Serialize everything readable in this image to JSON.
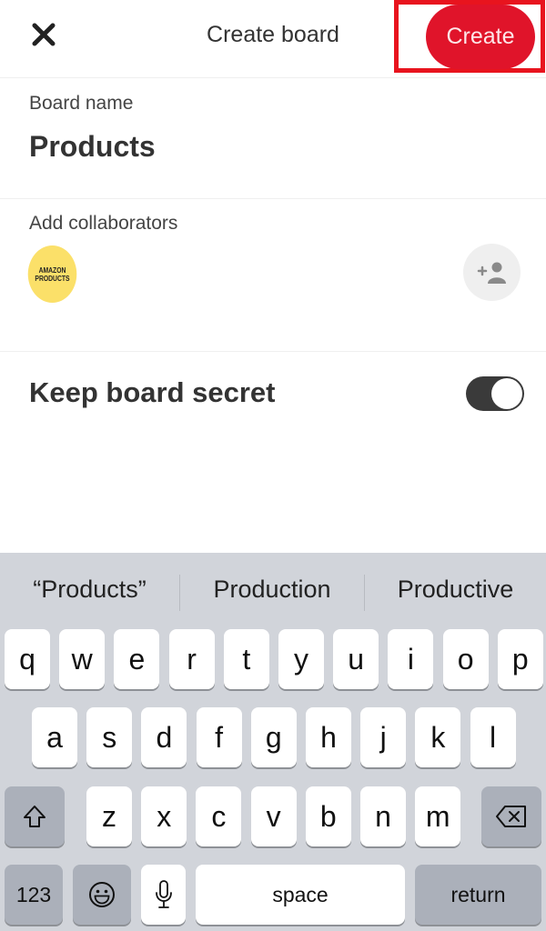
{
  "header": {
    "close_icon": "close-icon",
    "title": "Create board",
    "create_label": "Create",
    "create_color": "#e0142a",
    "highlight_color": "#e8141e"
  },
  "board_name": {
    "label": "Board name",
    "value": "Products"
  },
  "collaborators": {
    "label": "Add collaborators",
    "avatar_line1": "AMAZON",
    "avatar_line2": "PRODUCTS",
    "add_icon": "add-person-icon"
  },
  "secret": {
    "label": "Keep board secret",
    "enabled": true
  },
  "keyboard": {
    "suggestions": [
      "“Products”",
      "Production",
      "Productive"
    ],
    "row1": [
      "q",
      "w",
      "e",
      "r",
      "t",
      "y",
      "u",
      "i",
      "o",
      "p"
    ],
    "row2": [
      "a",
      "s",
      "d",
      "f",
      "g",
      "h",
      "j",
      "k",
      "l"
    ],
    "row3": [
      "z",
      "x",
      "c",
      "v",
      "b",
      "n",
      "m"
    ],
    "shift_icon": "shift-icon",
    "backspace_icon": "backspace-icon",
    "numbers_label": "123",
    "emoji_icon": "emoji-icon",
    "mic_icon": "microphone-icon",
    "space_label": "space",
    "return_label": "return"
  }
}
